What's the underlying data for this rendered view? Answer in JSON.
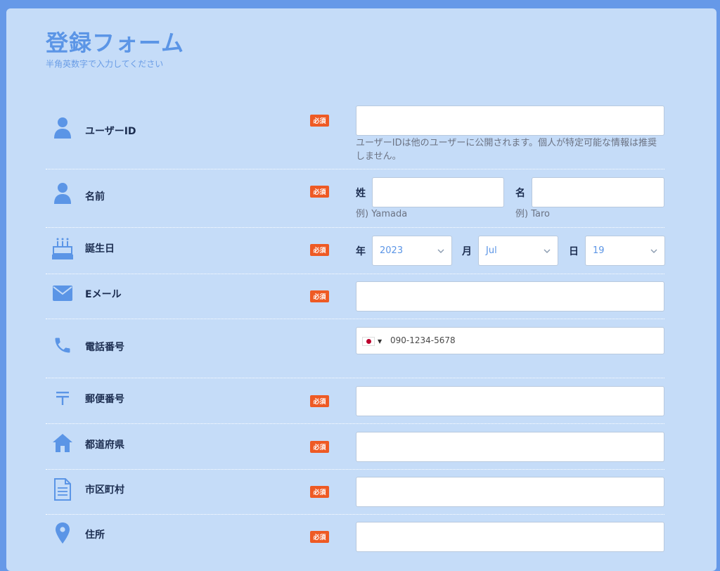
{
  "form": {
    "title": "登録フォーム",
    "subtitle": "半角英数字で入力してください",
    "required_label": "必須"
  },
  "fields": {
    "userid": {
      "label": "ユーザーID",
      "value": "",
      "hint": "ユーザーIDは他のユーザーに公開されます。個人が特定可能な情報は推奨しません。",
      "icon": "user-icon"
    },
    "name": {
      "label": "名前",
      "icon": "user-icon",
      "last_tag": "姓",
      "first_tag": "名",
      "last_hint": "例) Yamada",
      "first_hint": "例) Taro",
      "last_value": "",
      "first_value": ""
    },
    "birthday": {
      "label": "誕生日",
      "icon": "birthday-cake-icon",
      "year_tag": "年",
      "month_tag": "月",
      "day_tag": "日",
      "year": "2023",
      "month": "Jul",
      "day": "19"
    },
    "email": {
      "label": "Eメール",
      "icon": "mail-icon",
      "value": ""
    },
    "phone": {
      "label": "電話番号",
      "icon": "phone-icon",
      "country_flag": "japan-flag-icon",
      "value": "090-1234-5678"
    },
    "postal": {
      "label": "郵便番号",
      "icon": "postal-mark-icon",
      "value": ""
    },
    "prefecture": {
      "label": "都道府県",
      "icon": "home-icon",
      "value": ""
    },
    "city": {
      "label": "市区町村",
      "icon": "document-icon",
      "value": ""
    },
    "address": {
      "label": "住所",
      "icon": "map-pin-icon",
      "value": ""
    }
  },
  "colors": {
    "outer_background": "#6699e8",
    "card_background": "#c5dcf8",
    "accent": "#5b95e6",
    "required_badge": "#ee5a24",
    "label_text": "#1c2d50"
  }
}
